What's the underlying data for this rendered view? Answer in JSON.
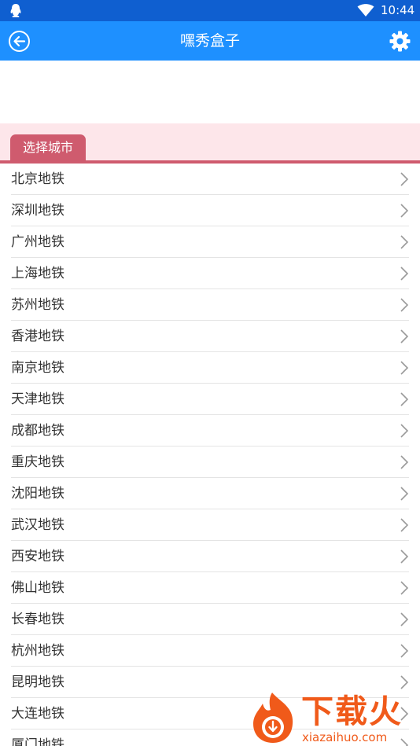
{
  "status_bar": {
    "time": "10:44",
    "icons": [
      "qq-icon",
      "wifi-icon"
    ]
  },
  "app_bar": {
    "title": "嘿秀盒子",
    "back_icon": "back-arrow-icon",
    "settings_icon": "gear-icon"
  },
  "section": {
    "tab_label": "选择城市"
  },
  "cities": [
    {
      "label": "北京地铁"
    },
    {
      "label": "深圳地铁"
    },
    {
      "label": "广州地铁"
    },
    {
      "label": "上海地铁"
    },
    {
      "label": "苏州地铁"
    },
    {
      "label": "香港地铁"
    },
    {
      "label": "南京地铁"
    },
    {
      "label": "天津地铁"
    },
    {
      "label": "成都地铁"
    },
    {
      "label": "重庆地铁"
    },
    {
      "label": "沈阳地铁"
    },
    {
      "label": "武汉地铁"
    },
    {
      "label": "西安地铁"
    },
    {
      "label": "佛山地铁"
    },
    {
      "label": "长春地铁"
    },
    {
      "label": "杭州地铁"
    },
    {
      "label": "昆明地铁"
    },
    {
      "label": "大连地铁"
    },
    {
      "label": "厦门地铁"
    }
  ],
  "watermark": {
    "brand": "下载火",
    "url": "xiazaihuo.com"
  },
  "colors": {
    "status_bar": "#0f5fd0",
    "app_bar": "#1e90ff",
    "section_bg": "#fde6ea",
    "accent": "#cf5b6e",
    "watermark": "#f05a1a"
  }
}
